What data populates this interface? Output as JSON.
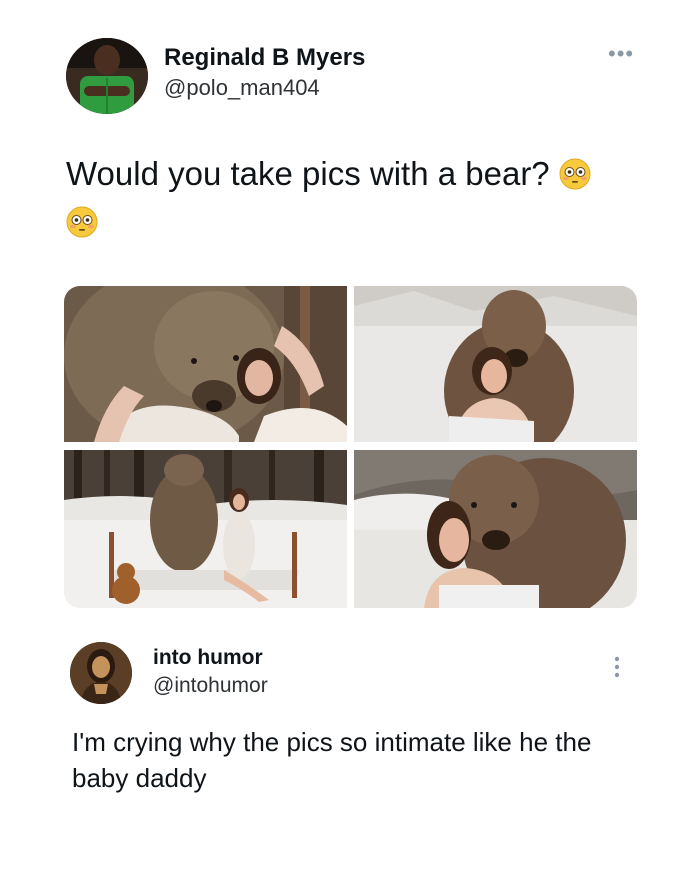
{
  "tweet": {
    "author_name": "Reginald B Myers",
    "author_handle": "@polo_man404",
    "more_label": "•••",
    "text": "Would you take pics with a bear?",
    "emoji": "flushed-face",
    "images": [
      "woman-with-bear-embrace",
      "woman-with-bear-snow",
      "woman-on-bed-with-bear",
      "bear-hugging-woman"
    ]
  },
  "reply": {
    "author_name": "into humor",
    "author_handle": "@intohumor",
    "text": "I'm crying why the pics so intimate like he the baby daddy"
  }
}
